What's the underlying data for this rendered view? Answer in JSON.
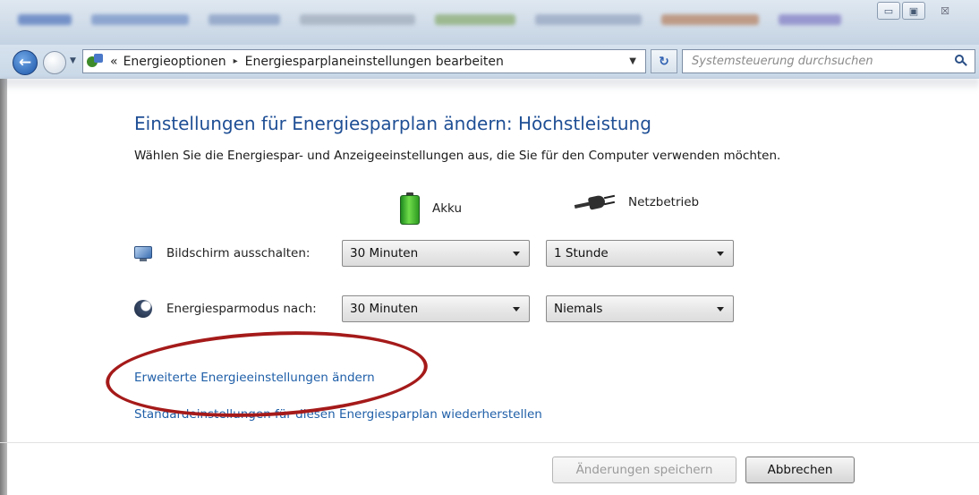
{
  "window": {
    "minimize_glyph": "▭",
    "maximize_glyph": "▣",
    "close_glyph": "☒"
  },
  "address_bar": {
    "separator": "«",
    "crumbs": [
      "Energieoptionen",
      "Energiesparplaneinstellungen bearbeiten"
    ],
    "crumb_sep": "▸",
    "dropdown_glyph": "▼",
    "refresh_glyph": "↻"
  },
  "search": {
    "placeholder": "Systemsteuerung durchsuchen"
  },
  "main": {
    "title": "Einstellungen für Energiesparplan ändern: Höchstleistung",
    "subtitle": "Wählen Sie die Energiespar- und Anzeigeeinstellungen aus, die Sie für den Computer verwenden möchten.",
    "columns": {
      "battery": "Akku",
      "plugged": "Netzbetrieb"
    },
    "settings": [
      {
        "label": "Bildschirm ausschalten:",
        "battery": "30 Minuten",
        "plugged": "1 Stunde"
      },
      {
        "label": "Energiesparmodus nach:",
        "battery": "30 Minuten",
        "plugged": "Niemals"
      }
    ],
    "links": {
      "advanced": "Erweiterte Energieeinstellungen ändern",
      "restore": "Standardeinstellungen für diesen Energiesparplan wiederherstellen"
    }
  },
  "footer": {
    "save": "Änderungen speichern",
    "cancel": "Abbrechen"
  },
  "colors": {
    "title_blue": "#1f4f95",
    "link_blue": "#1f5fa8",
    "highlight_red": "#a51a1a"
  },
  "icons": [
    "back-arrow-icon",
    "forward-arrow-icon",
    "control-panel-icon",
    "refresh-icon",
    "search-icon",
    "battery-icon",
    "power-plug-icon",
    "monitor-icon",
    "moon-icon"
  ]
}
